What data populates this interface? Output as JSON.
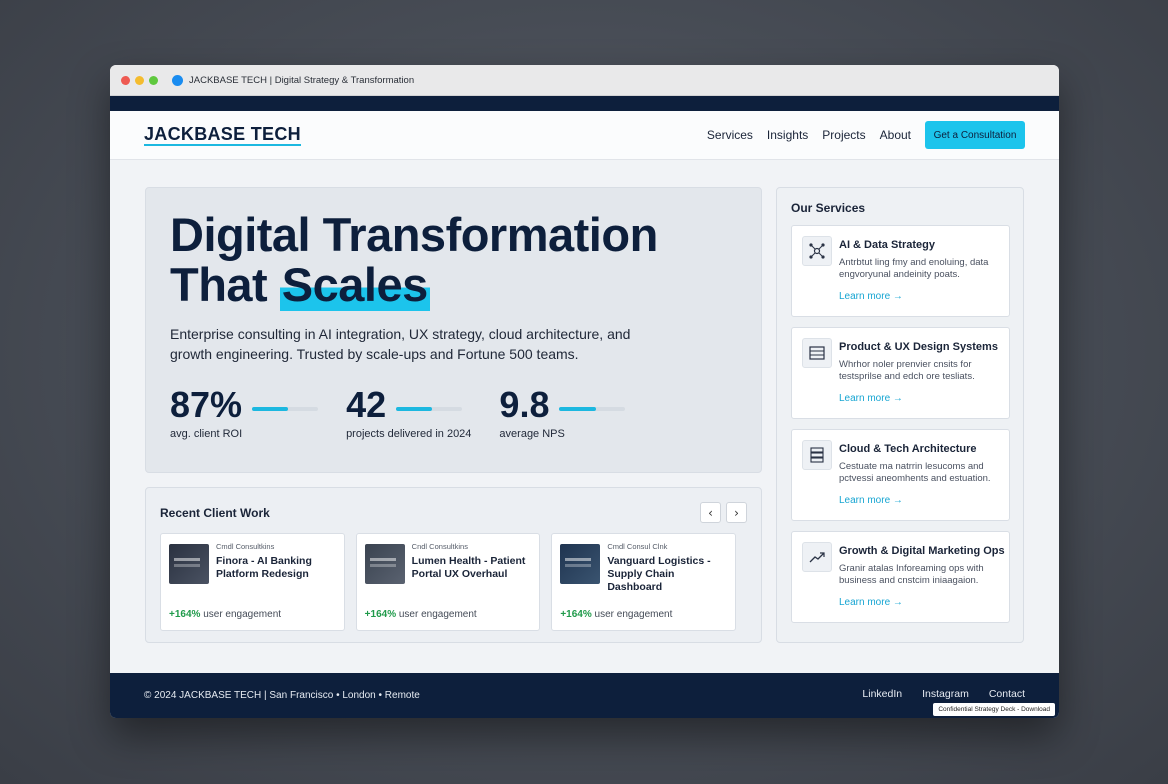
{
  "browser": {
    "tab_title": "JACKBASE TECH | Digital Strategy & Transformation"
  },
  "header": {
    "logo": "JACKBASE TECH",
    "nav": [
      "Services",
      "Insights",
      "Projects",
      "About"
    ],
    "cta": "Get a Consultation"
  },
  "hero": {
    "title_line1": "Digital Transformation",
    "title_line2_pre": "That ",
    "title_highlight": "Scales",
    "subtitle": "Enterprise consulting in AI integration, UX strategy, cloud architecture, and growth engineering. Trusted by scale-ups and Fortune 500 teams.",
    "stats": [
      {
        "value": "87%",
        "label": "avg. client ROI",
        "fill": 0.55
      },
      {
        "value": "42",
        "label": "projects delivered in 2024",
        "fill": 0.55
      },
      {
        "value": "9.8",
        "label": "average NPS",
        "fill": 0.55
      }
    ]
  },
  "recent": {
    "title": "Recent Client Work",
    "prev": "‹",
    "next": "›",
    "cards": [
      {
        "category": "Cmdl Consultkins",
        "name": "Finora - AI Banking Platform Redesign",
        "metric_value": "+164%",
        "metric_label": " user engagement"
      },
      {
        "category": "Cndl Consultkins",
        "name": "Lumen Health - Patient Portal UX Overhaul",
        "metric_value": "+164%",
        "metric_label": " user engagement"
      },
      {
        "category": "Cmdl Consul Clnk",
        "name": "Vanguard Logistics - Supply Chain Dashboard",
        "metric_value": "+164%",
        "metric_label": " user engagement"
      }
    ]
  },
  "services": {
    "title": "Our Services",
    "items": [
      {
        "icon": "network-icon",
        "name": "AI & Data Strategy",
        "desc": "Antrbtut ling fmy and enoluing, data engvoryunal andeinity poats.",
        "link": "Learn more →"
      },
      {
        "icon": "layout-icon",
        "name": "Product & UX Design Systems",
        "desc": "Whrhor noler prenvier cnsits for testsprilse and edch ore tesliats.",
        "link": "Learn more →"
      },
      {
        "icon": "server-icon",
        "name": "Cloud & Tech Architecture",
        "desc": "Cestuate ma natrrin lesucoms and pctvessi aneomhents and estuation.",
        "link": "Learn more →"
      },
      {
        "icon": "trend-icon",
        "name": "Growth & Digital Marketing Ops",
        "desc": "Granir atalas Inforeaming ops with business and cnstcim iniaagaion.",
        "link": "Learn more →"
      }
    ]
  },
  "footer": {
    "copyright": "© 2024 JACKBASE TECH | San Francisco • London • Remote",
    "links": [
      "LinkedIn",
      "Instagram",
      "Contact"
    ],
    "confidential": "Confidential Strategy Deck - Download"
  },
  "colors": {
    "navy": "#0d1f3c",
    "accent": "#1cc4ec",
    "positive": "#1f9a4a"
  }
}
